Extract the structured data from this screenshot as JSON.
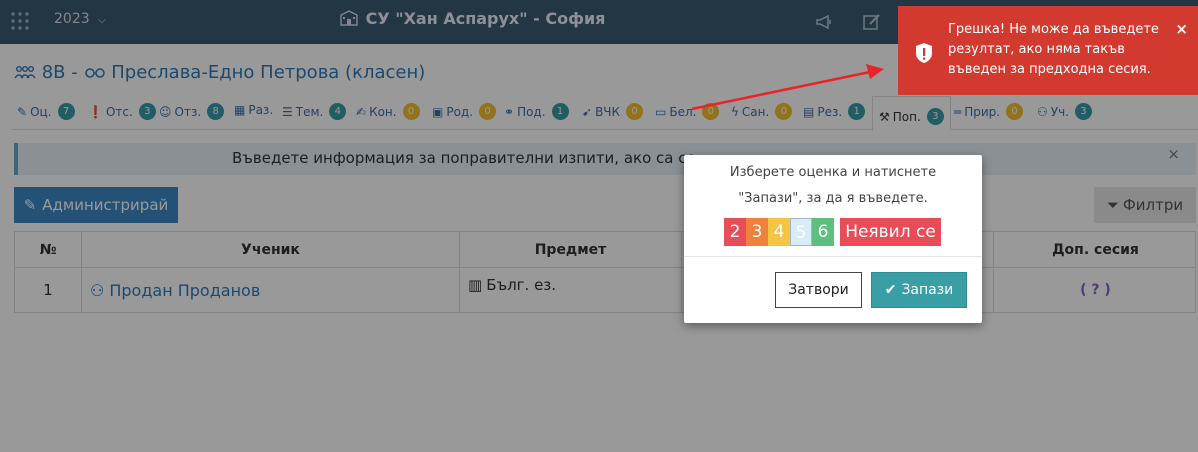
{
  "topbar": {
    "year": "2023",
    "school": "СУ \"Хан Аспарух\" - София"
  },
  "page": {
    "class_label": "8В",
    "student_name": "Преслава-Едно Петрова (класен)"
  },
  "tabs": [
    {
      "label": "Оц.",
      "count": "7",
      "color": "teal"
    },
    {
      "label": "Отс.",
      "count": "3",
      "color": "teal"
    },
    {
      "label": "Отз.",
      "count": "8",
      "color": "teal"
    },
    {
      "label": "Раз.",
      "count": "",
      "color": ""
    },
    {
      "label": "Тем.",
      "count": "4",
      "color": "teal"
    },
    {
      "label": "Кон.",
      "count": "0",
      "color": "yellow"
    },
    {
      "label": "Род.",
      "count": "0",
      "color": "yellow"
    },
    {
      "label": "Под.",
      "count": "1",
      "color": "teal"
    },
    {
      "label": "ВЧК",
      "count": "0",
      "color": "yellow"
    },
    {
      "label": "Бел.",
      "count": "0",
      "color": "yellow"
    },
    {
      "label": "Сан.",
      "count": "0",
      "color": "yellow"
    },
    {
      "label": "Рез.",
      "count": "1",
      "color": "teal"
    },
    {
      "label": "Поп.",
      "count": "3",
      "color": "teal"
    },
    {
      "label": "Прир.",
      "count": "0",
      "color": "yellow"
    },
    {
      "label": "Уч.",
      "count": "3",
      "color": "teal"
    }
  ],
  "info": {
    "text": "Въведете информация за поправителни изпити, ако са се",
    "close": "×"
  },
  "actions": {
    "admin_label": "Администрирай",
    "filter_label": "Филтри"
  },
  "table": {
    "headers": [
      "№",
      "Ученик",
      "Предмет",
      "",
      "Доп. сесия"
    ],
    "rows": [
      {
        "num": "1",
        "student": "Продан Проданов",
        "subject": "Бълг. ез.",
        "extra": "",
        "session": "( ? )"
      }
    ]
  },
  "modal": {
    "line1": "Изберете оценка и натиснете",
    "line2": "\"Запази\", за да я въведете.",
    "grades": [
      "2",
      "3",
      "4",
      "5",
      "6"
    ],
    "grade_colors": [
      "#e84c57",
      "#f0813d",
      "#f4c542",
      "#d8ecf8",
      "#5fbf7f"
    ],
    "selected_grade": "5",
    "noshow_label": "Неявил се",
    "close_label": "Затвори",
    "save_label": "Запази"
  },
  "toast": {
    "message": "Грешка! Не може да въведете резултат, ако няма такъв въведен за предходна сесия.",
    "close": "×"
  },
  "colors": {
    "topbar": "#3b5a72",
    "accent": "#3d87c5",
    "toast": "#d23a30",
    "save": "#3a9ea5"
  }
}
